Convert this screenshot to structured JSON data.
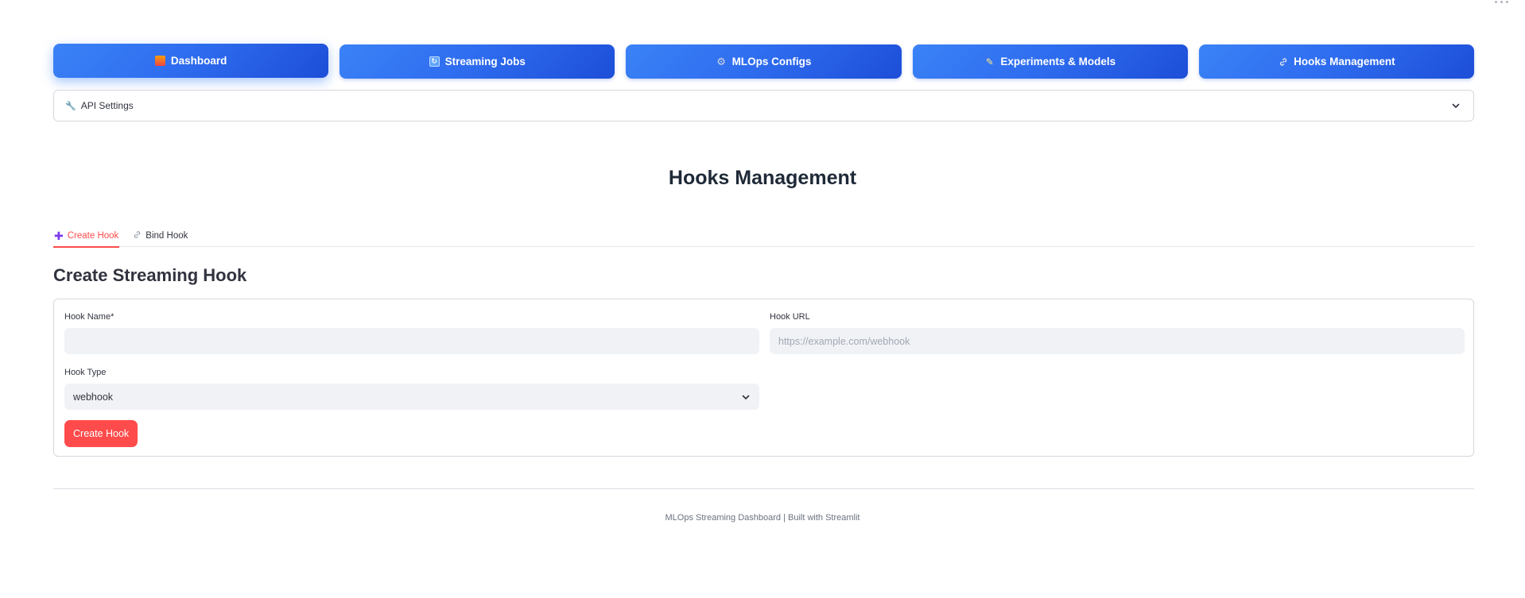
{
  "nav": {
    "items": [
      {
        "label": "Dashboard",
        "icon": "dashboard-icon",
        "active": true
      },
      {
        "label": "Streaming Jobs",
        "icon": "refresh-icon",
        "active": false
      },
      {
        "label": "MLOps Configs",
        "icon": "gear-icon",
        "active": false
      },
      {
        "label": "Experiments & Models",
        "icon": "pencil-icon",
        "active": false
      },
      {
        "label": "Hooks Management",
        "icon": "link-icon",
        "active": false
      }
    ]
  },
  "api_settings": {
    "label": "API Settings",
    "icon": "wrench-icon",
    "expanded": false
  },
  "page": {
    "title": "Hooks Management"
  },
  "tabs": [
    {
      "label": "Create Hook",
      "icon": "plus-icon",
      "active": true
    },
    {
      "label": "Bind Hook",
      "icon": "link-icon",
      "active": false
    }
  ],
  "section": {
    "title": "Create Streaming Hook"
  },
  "form": {
    "hook_name": {
      "label": "Hook Name*",
      "value": "",
      "placeholder": ""
    },
    "hook_url": {
      "label": "Hook URL",
      "value": "",
      "placeholder": "https://example.com/webhook"
    },
    "hook_type": {
      "label": "Hook Type",
      "selected": "webhook"
    },
    "submit_label": "Create Hook"
  },
  "footer": {
    "text": "MLOps Streaming Dashboard | Built with Streamlit"
  },
  "colors": {
    "nav_gradient_start": "#3b82f6",
    "nav_gradient_end": "#1d4ed8",
    "accent": "#ff4b4b",
    "input_bg": "#f0f2f6",
    "border": "#d6d8de"
  }
}
